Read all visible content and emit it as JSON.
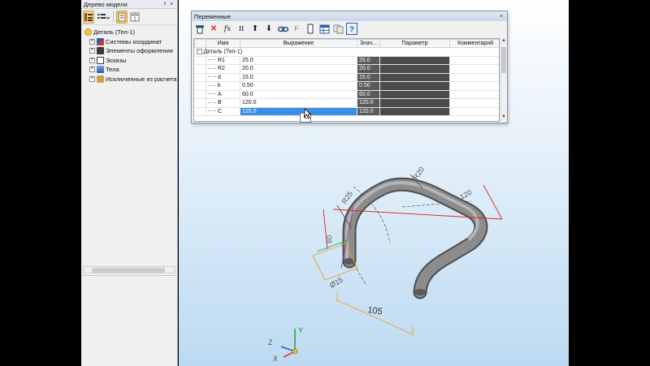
{
  "tree_panel": {
    "title": "Дерево модели",
    "pin_label": "ᵖ",
    "close_label": "×",
    "toolbar": [
      "tree-view",
      "list-view",
      "doc-view",
      "split-view"
    ],
    "root": {
      "label": "Деталь (Тел-1)",
      "icon": "part-icon"
    },
    "items": [
      {
        "label": "Системы координат",
        "icon": "coordinate-system-icon"
      },
      {
        "label": "Элементы оформления",
        "icon": "annotation-icon"
      },
      {
        "label": "Эскизы",
        "icon": "sketch-icon"
      },
      {
        "label": "Тела",
        "icon": "body-icon"
      },
      {
        "label": "Исключенные из расчета",
        "icon": "excluded-icon"
      }
    ]
  },
  "variables_dialog": {
    "title": "Переменные",
    "close_label": "×",
    "toolbar": [
      "table-icon",
      "delete-icon",
      "function-icon",
      "pi-icon",
      "move-up-icon",
      "move-down-icon",
      "link-icon",
      "external-var-icon",
      "device-icon",
      "spreadsheet-icon",
      "copy-icon",
      "help-icon"
    ],
    "columns": [
      "Имя",
      "Выражение",
      "Знач...",
      "Параметр",
      "Комментарий"
    ],
    "group": "Деталь (Тел-1)",
    "rows": [
      {
        "name": "R1",
        "expr": "25.0",
        "value": "25.0"
      },
      {
        "name": "R2",
        "expr": "20.0",
        "value": "20.0"
      },
      {
        "name": "d",
        "expr": "15.0",
        "value": "15.0"
      },
      {
        "name": "k",
        "expr": "0.50",
        "value": "0.50"
      },
      {
        "name": "A",
        "expr": "60.0",
        "value": "60.0"
      },
      {
        "name": "B",
        "expr": "120.0",
        "value": "120.0"
      },
      {
        "name": "C",
        "expr": "120.0",
        "value": "120.0"
      }
    ],
    "tooltip": "C"
  },
  "model": {
    "dims": {
      "R_top": "R20",
      "R_left": "R25",
      "len_top": "120",
      "height": "60",
      "dia": "Ø15",
      "len_bottom": "105"
    },
    "axes": {
      "x": "X",
      "y": "Y",
      "z": "Z"
    }
  },
  "colors": {
    "tube": "#7a7a7a",
    "dim_red": "#e02020",
    "dim_orange": "#f0a020",
    "dim_purple": "#8a3fa8",
    "selection": "#3d8ee0"
  }
}
